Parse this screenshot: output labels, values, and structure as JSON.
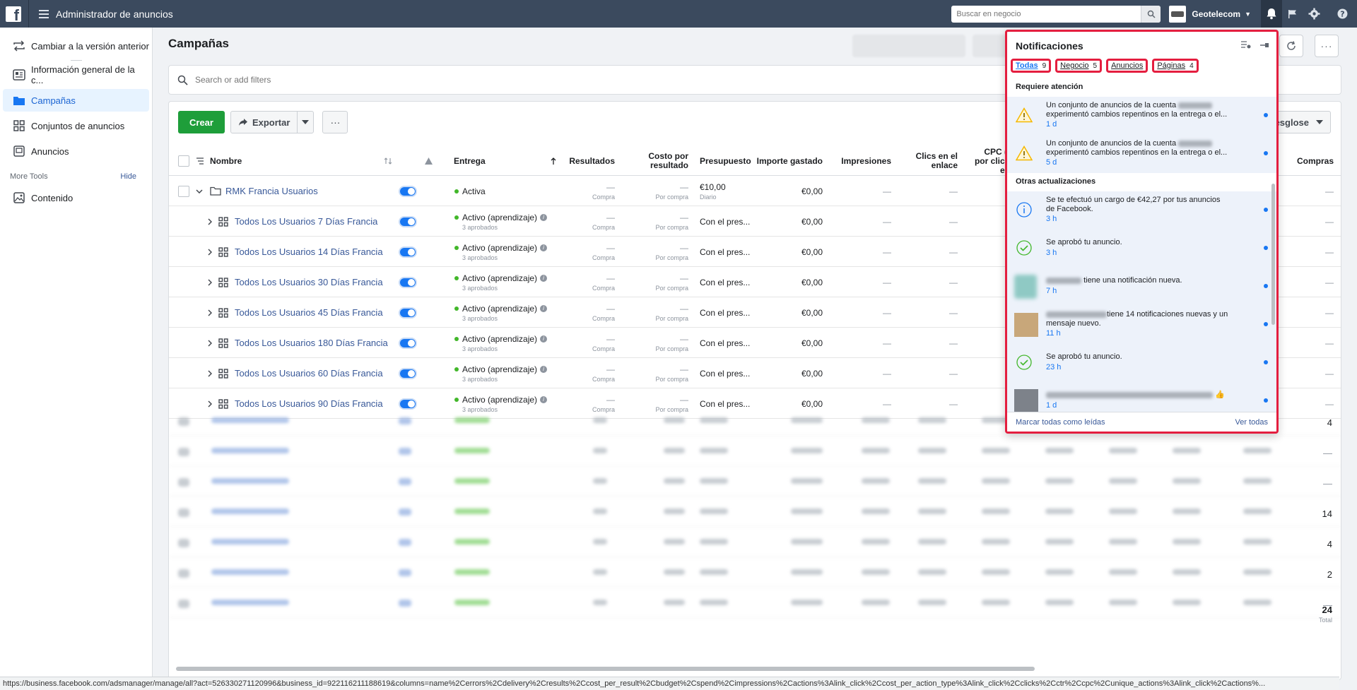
{
  "app": {
    "title": "Administrador de anuncios",
    "search_placeholder": "Buscar en negocio",
    "account_name": "Geotelecom"
  },
  "sidebar": {
    "items": [
      {
        "label": "Cambiar a la versión anterior"
      },
      {
        "label": "Información general de la c..."
      },
      {
        "label": "Campañas"
      },
      {
        "label": "Conjuntos de anuncios"
      },
      {
        "label": "Anuncios"
      }
    ],
    "more_tools": "More Tools",
    "hide": "Hide",
    "tools": [
      {
        "label": "Contenido"
      }
    ]
  },
  "page": {
    "title": "Campañas",
    "filter_placeholder": "Search or add filters"
  },
  "toolbar": {
    "create": "Crear",
    "export": "Exportar",
    "breakdown": "esglose"
  },
  "table": {
    "headers": {
      "name": "Nombre",
      "delivery": "Entrega",
      "results": "Resultados",
      "cost_line1": "Costo por",
      "cost_line2": "resultado",
      "budget": "Presupuesto",
      "spent": "Importe gastado",
      "impressions": "Impresiones",
      "clicks_line1": "Clics en el",
      "clicks_line2": "enlace",
      "cpc_line1": "CPC (co",
      "cpc_line2": "por clic en",
      "cpc_line3": "enla",
      "purchases": "Compras"
    },
    "campaign": {
      "name": "RMK Francia Usuarios",
      "delivery": "Activa",
      "results": "—",
      "results_sub": "Compra",
      "cost": "—",
      "cost_sub": "Por compra",
      "budget": "€10,00",
      "budget_sub": "Diario",
      "spent": "€0,00",
      "impressions": "—",
      "clicks": "—",
      "purchases": "—"
    },
    "adsets": [
      {
        "name": "Todos Los Usuarios 7 Días Francia"
      },
      {
        "name": "Todos Los Usuarios 14 Días Francia"
      },
      {
        "name": "Todos Los Usuarios 30 Días Francia"
      },
      {
        "name": "Todos Los Usuarios 45 Días Francia"
      },
      {
        "name": "Todos Los Usuarios 180 Días Francia"
      },
      {
        "name": "Todos Los Usuarios 60 Días Francia"
      },
      {
        "name": "Todos Los Usuarios 90 Días Francia"
      }
    ],
    "adset_common": {
      "delivery": "Activo (aprendizaje)",
      "delivery_sub": "3 aprobados",
      "results": "—",
      "results_sub": "Compra",
      "cost": "—",
      "cost_sub": "Por compra",
      "budget": "Con el pres...",
      "spent": "€0,00",
      "impressions": "—",
      "clicks": "—",
      "purchases": "—"
    },
    "blurred_purchases": [
      "4",
      "—",
      "—",
      "14",
      "4",
      "2",
      "—"
    ],
    "total_purchases": "24",
    "total_label": "Total"
  },
  "statusbar": {
    "url": "https://business.facebook.com/adsmanager/manage/all?act=526330271120996&business_id=922116211188619&columns=name%2Cerrors%2Cdelivery%2Cresults%2Ccost_per_result%2Cbudget%2Cspend%2Cimpressions%2Cactions%3Alink_click%2Ccost_per_action_type%3Alink_click%2Cclicks%2Cctr%2Ccpc%2Cunique_actions%3Alink_click%2Cactions%..."
  },
  "notifications": {
    "title": "Notificaciones",
    "tabs": [
      {
        "label": "Todas",
        "count": "9"
      },
      {
        "label": "Negocio",
        "count": "5"
      },
      {
        "label": "Anuncios",
        "count": ""
      },
      {
        "label": "Páginas",
        "count": "4"
      }
    ],
    "attention_title": "Requiere atención",
    "attention": [
      {
        "text1": "Un conjunto de anuncios de la cuenta",
        "text2": "experimentó cambios repentinos en la entrega o el...",
        "time": "1 d"
      },
      {
        "text1": "Un conjunto de anuncios de la cuenta",
        "text2": "experimentó cambios repentinos en la entrega o el...",
        "time": "5 d"
      }
    ],
    "updates_title": "Otras actualizaciones",
    "updates": [
      {
        "text": "Se te efectuó un cargo de €42,27 por tus anuncios de Facebook.",
        "time": "3 h"
      },
      {
        "text": "Se aprobó tu anuncio.",
        "time": "3 h"
      },
      {
        "text": "tiene una notificación nueva.",
        "time": "7 h"
      },
      {
        "text": "tiene 14 notificaciones nuevas y un mensaje nuevo.",
        "time": "11 h"
      },
      {
        "text": "Se aprobó tu anuncio.",
        "time": "23 h"
      },
      {
        "text": "👍",
        "time": "1 d"
      }
    ],
    "mark_all": "Marcar todas como leídas",
    "see_all": "Ver todas"
  },
  "colors": {
    "topbar": "#3b4a5e",
    "accent": "#1877f2",
    "create_green": "#1e9e3a",
    "highlight_red": "#e41e3f"
  }
}
